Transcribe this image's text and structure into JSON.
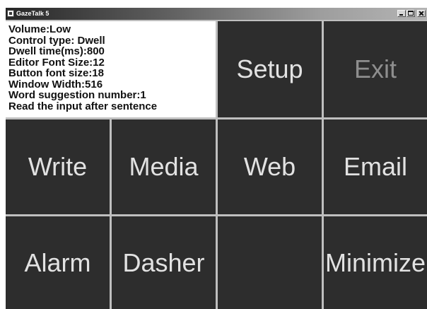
{
  "window": {
    "title": "GazeTalk 5",
    "icon": "app-icon",
    "controls": [
      "minimize-icon",
      "maximize-icon",
      "close-icon"
    ]
  },
  "info_panel": {
    "lines": [
      "Volume:Low",
      "Control type: Dwell",
      "Dwell time(ms):800",
      "Editor Font Size:12",
      "Button font size:18",
      "Window Width:516",
      "Word suggestion number:1",
      "Read the input after sentence"
    ]
  },
  "buttons": [
    {
      "label": "Setup"
    },
    {
      "label": "Exit",
      "dimmed": true
    },
    {
      "label": "Write"
    },
    {
      "label": "Media"
    },
    {
      "label": "Web"
    },
    {
      "label": "Email"
    },
    {
      "label": "Alarm"
    },
    {
      "label": "Dasher"
    },
    {
      "label": "Minimize"
    }
  ],
  "colors": {
    "panel_bg": "#ffffff",
    "cell_bg": "#2d2d2d",
    "label": "#e2e2e2",
    "label_dimmed": "#8e8e8e",
    "grid_gap": "#bfbfbf",
    "info_text": "#111111"
  }
}
